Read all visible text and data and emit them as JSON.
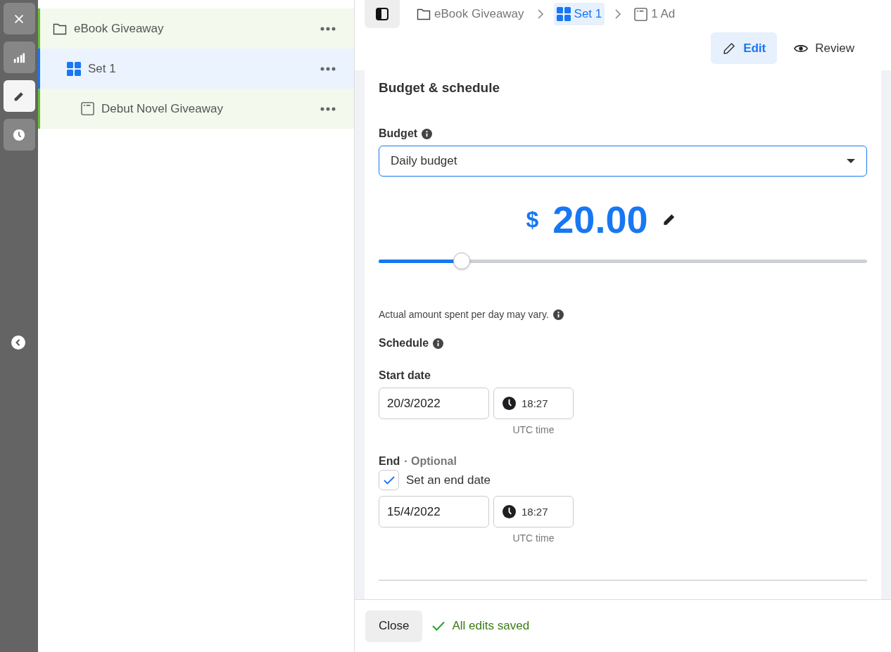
{
  "rail": {
    "items": [
      {
        "kind": "close",
        "selected": false
      },
      {
        "kind": "chart",
        "selected": false
      },
      {
        "kind": "edit",
        "selected": true
      },
      {
        "kind": "history",
        "selected": false
      }
    ]
  },
  "tree": [
    {
      "kind": "campaign",
      "label": "eBook Giveaway",
      "selected": false,
      "children": [
        {
          "kind": "set",
          "label": "Set 1",
          "selected": true,
          "children": [
            {
              "kind": "ad",
              "label": "Debut Novel Giveaway",
              "selected": false
            }
          ]
        }
      ]
    }
  ],
  "breadcrumbs": [
    {
      "kind": "campaign",
      "label": "eBook Giveaway",
      "selected": false
    },
    {
      "kind": "set",
      "label": "Set 1",
      "selected": true
    },
    {
      "kind": "ad",
      "label": "1 Ad",
      "selected": false
    }
  ],
  "modes": [
    {
      "kind": "edit",
      "label": "Edit",
      "selected": true
    },
    {
      "kind": "review",
      "label": "Review",
      "selected": false
    }
  ],
  "section_title": "Budget & schedule",
  "budget": {
    "label": "Budget",
    "type": "Daily budget",
    "currency": "$",
    "amount": "20.00",
    "level": 0.17,
    "note": "Actual amount spent per day may vary."
  },
  "schedule": {
    "label": "Schedule",
    "start": {
      "label": "Start date",
      "date": "20/3/2022",
      "time": "18:27",
      "timezone": "UTC time"
    },
    "end": {
      "label": "End",
      "optional": "· Optional",
      "checkbox_label": "Set an end date",
      "checked": true,
      "date": "15/4/2022",
      "time": "18:27",
      "timezone": "UTC time"
    }
  },
  "footer": {
    "close": "Close",
    "status": "All edits saved"
  }
}
